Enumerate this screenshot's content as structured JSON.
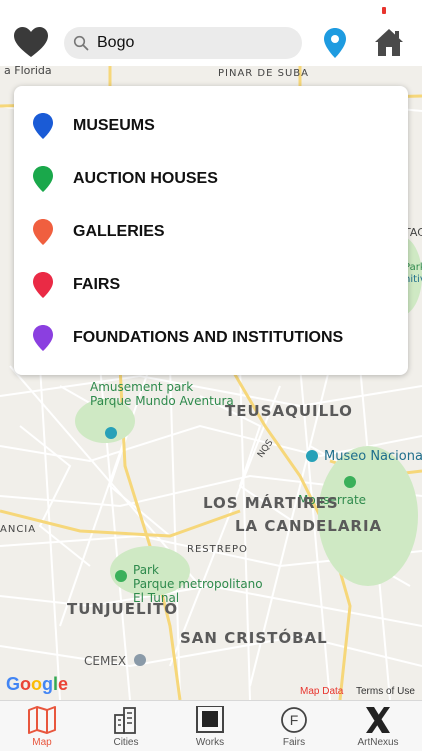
{
  "search": {
    "value": "Bogo",
    "placeholder": ""
  },
  "legend": [
    {
      "label": "MUSEUMS",
      "color": "#1a5bd6"
    },
    {
      "label": "AUCTION HOUSES",
      "color": "#1aa84b"
    },
    {
      "label": "GALLERIES",
      "color": "#f05f3f"
    },
    {
      "label": "FAIRS",
      "color": "#ea2a45"
    },
    {
      "label": "FOUNDATIONS AND INSTITUTIONS",
      "color": "#8b3fe0"
    }
  ],
  "map": {
    "streets": [
      "PINAR DE SUBA",
      "a Florida",
      "NQS",
      "RESTREPO",
      "ANCIA",
      "TAC",
      "Park",
      "nitivo"
    ],
    "districts": [
      "TEUSAQUILLO",
      "LOS MÁRTIRES",
      "LA CANDELARIA",
      "TUNJUELITO",
      "SAN CRISTÓBAL"
    ],
    "pois": [
      "Amusement park",
      "Parque Mundo Aventura",
      "Museo Nacional",
      "Monserrate",
      "Park",
      "Parque metropolitano",
      "El Tunal",
      "CEMEX"
    ],
    "attribution": {
      "google": "Google",
      "map_data": "Map Data",
      "terms": "Terms of Use"
    }
  },
  "tabs": [
    {
      "label": "Map",
      "icon": "map-icon",
      "active": true
    },
    {
      "label": "Cities",
      "icon": "cities-icon",
      "active": false
    },
    {
      "label": "Works",
      "icon": "works-icon",
      "active": false
    },
    {
      "label": "Fairs",
      "icon": "fairs-icon",
      "active": false
    },
    {
      "label": "ArtNexus",
      "icon": "artnexus-icon",
      "active": false
    }
  ],
  "colors": {
    "accent": "#e8563d",
    "location_pin": "#1e9be0"
  }
}
